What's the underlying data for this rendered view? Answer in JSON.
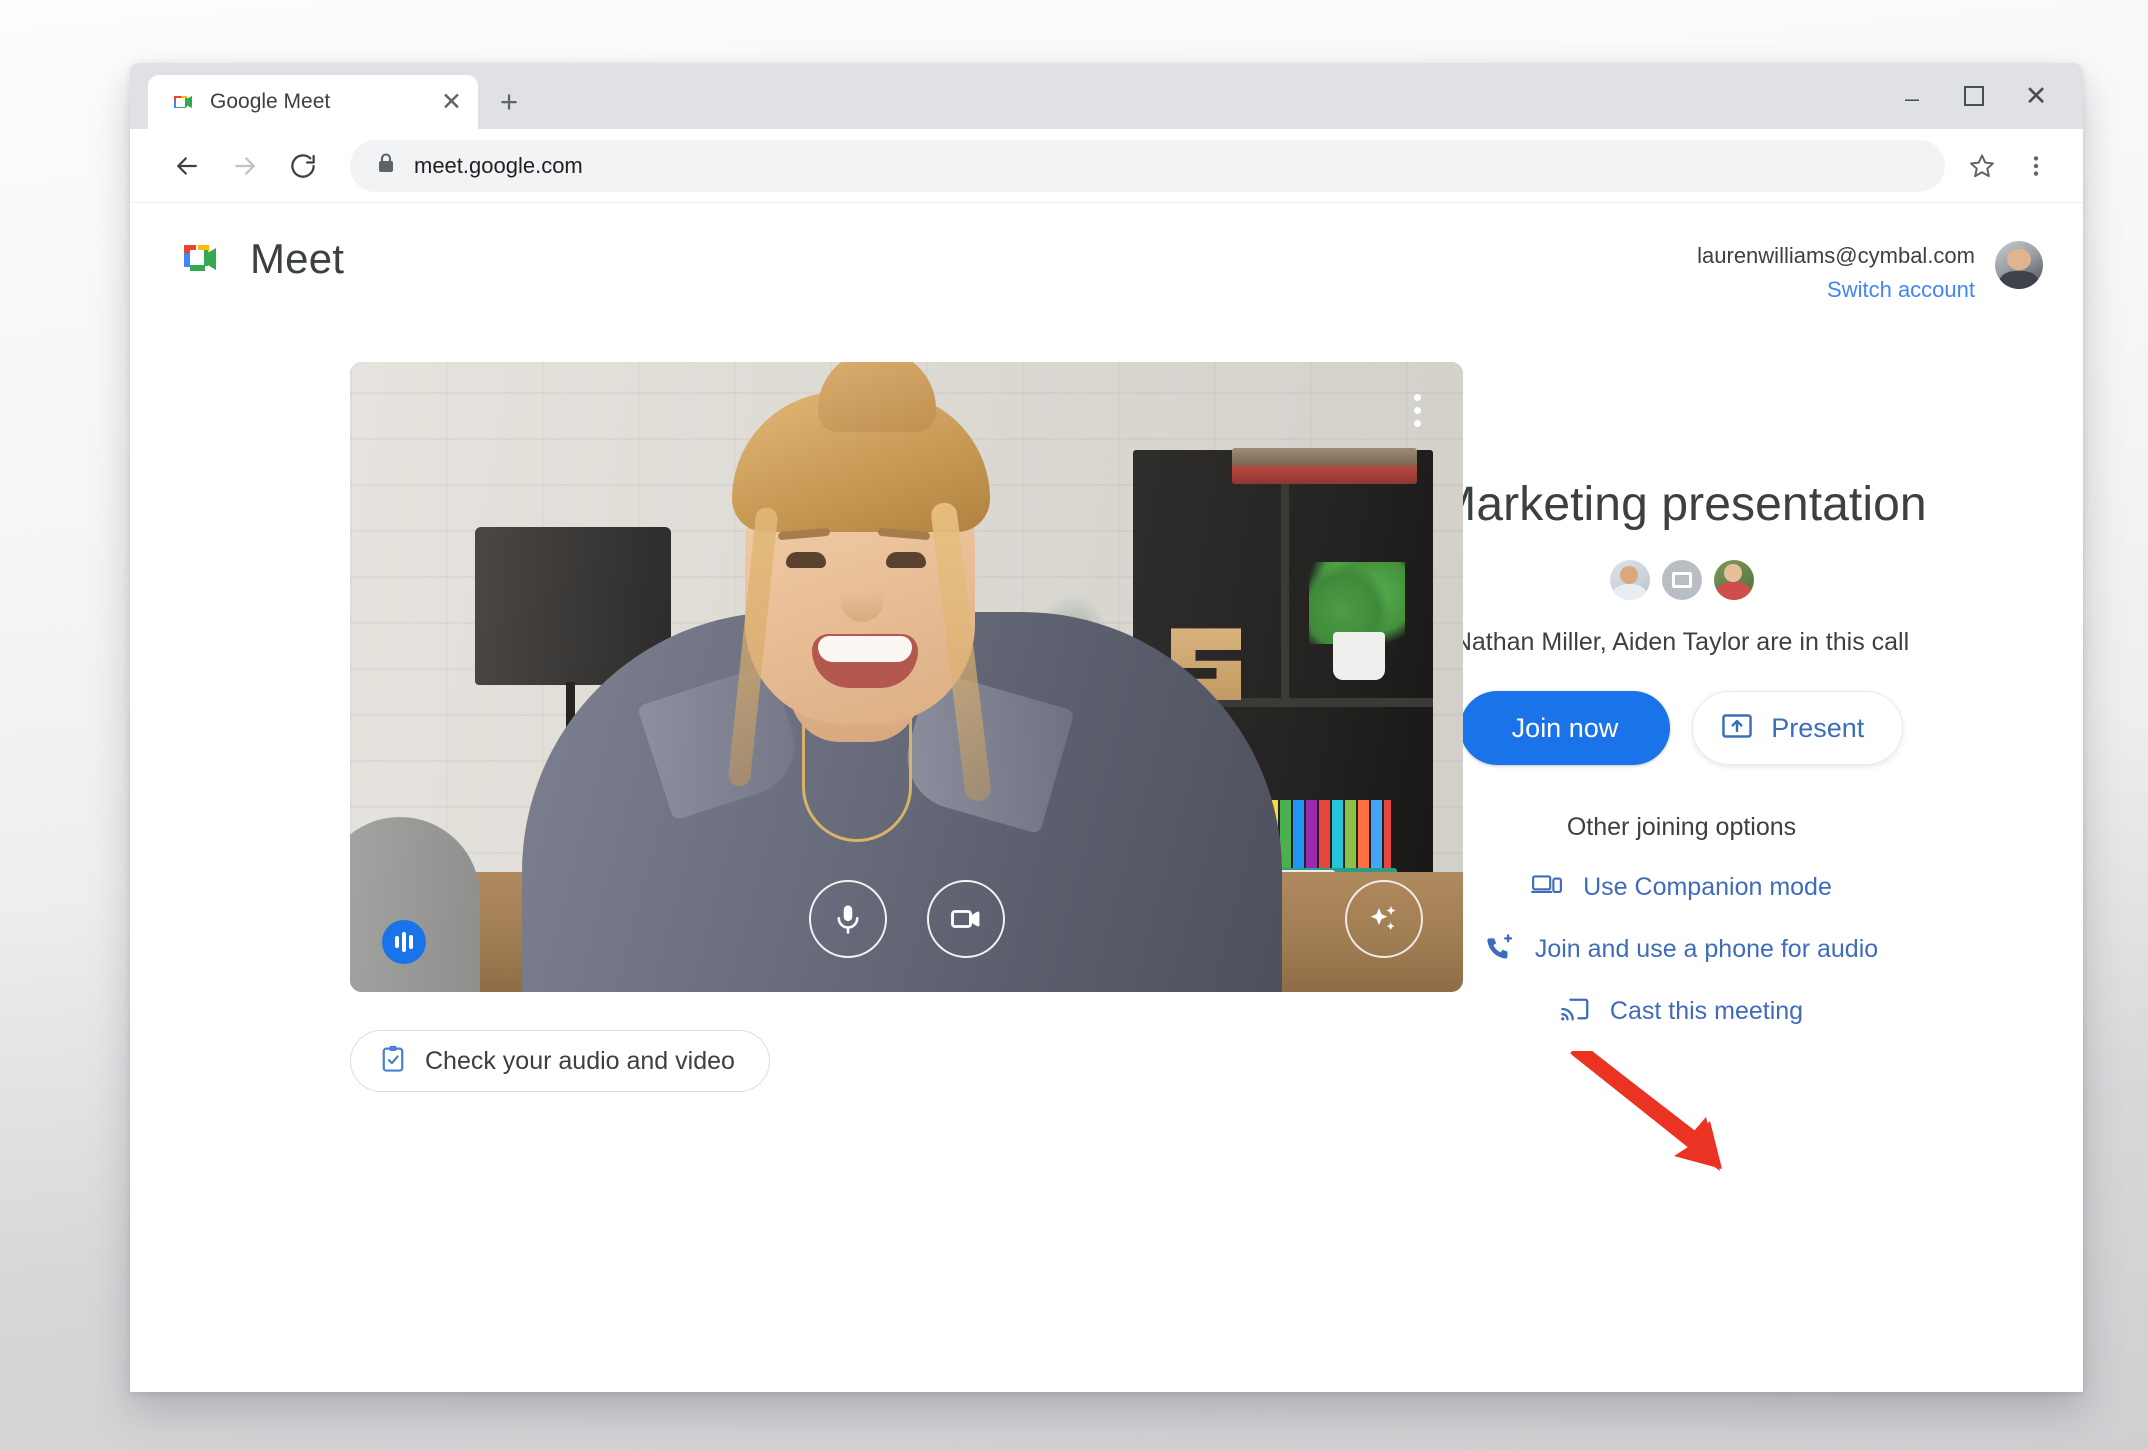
{
  "browser": {
    "tab": {
      "title": "Google Meet",
      "favicon_icon": "google-meet-favicon",
      "close_icon": "close-icon"
    },
    "new_tab_icon": "plus-icon",
    "window_controls": {
      "minimize_icon": "minimize-icon",
      "maximize_icon": "maximize-icon",
      "close_icon": "close-icon"
    },
    "nav": {
      "back_icon": "back-arrow-icon",
      "forward_icon": "forward-arrow-icon",
      "reload_icon": "reload-icon"
    },
    "omnibox": {
      "url": "meet.google.com",
      "lock_icon": "lock-icon"
    },
    "star_icon": "bookmark-star-icon",
    "menu_icon": "chrome-menu-icon"
  },
  "page": {
    "brand": {
      "name": "Meet",
      "logo_icon": "google-meet-logo-icon"
    },
    "account": {
      "email": "laurenwilliams@cymbal.com",
      "switch_label": "Switch account",
      "avatar_icon": "user-avatar"
    },
    "preview": {
      "audio_indicator_icon": "audio-level-icon",
      "more_options_icon": "more-vertical-icon",
      "mic_icon": "microphone-icon",
      "camera_icon": "camera-icon",
      "effects_icon": "sparkle-effects-icon",
      "check_av_label": "Check your audio and video",
      "check_av_icon": "clipboard-check-icon"
    },
    "meeting": {
      "title": "Marketing presentation",
      "participants_text": "Nathan Miller, Aiden Taylor are in this call",
      "avatars": [
        "participant-avatar-1",
        "presentation-avatar",
        "participant-avatar-2"
      ],
      "join_label": "Join now",
      "present_label": "Present",
      "present_icon": "present-screen-icon",
      "other_options_title": "Other joining options",
      "options": [
        {
          "label": "Use Companion mode",
          "icon": "companion-mode-icon"
        },
        {
          "label": "Join and use a phone for audio",
          "icon": "phone-audio-icon"
        },
        {
          "label": "Cast this meeting",
          "icon": "cast-icon"
        }
      ]
    }
  },
  "annotation": {
    "arrow_icon": "red-pointer-arrow",
    "color": "#ea3323"
  },
  "colors": {
    "accent_blue": "#1a73e8",
    "link_blue": "#3f6bbd",
    "text_primary": "#3c4043",
    "tab_bar": "#dfe1e5"
  }
}
